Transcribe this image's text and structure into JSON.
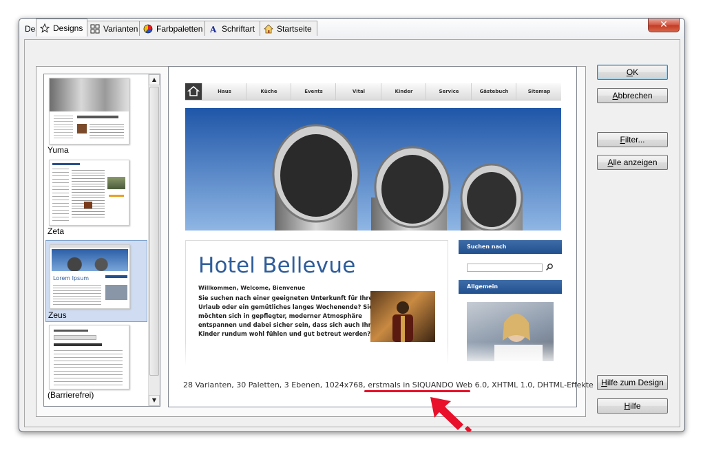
{
  "window": {
    "title": "Design auswählen",
    "close_glyph": "✕"
  },
  "tabs": [
    {
      "label": "Designs",
      "icon": "star-icon",
      "active": true
    },
    {
      "label": "Varianten",
      "icon": "grid-icon",
      "active": false
    },
    {
      "label": "Farbpaletten",
      "icon": "color-wheel-icon",
      "active": false
    },
    {
      "label": "Schriftart",
      "icon": "font-icon",
      "active": false
    },
    {
      "label": "Startseite",
      "icon": "home-icon",
      "active": false
    }
  ],
  "design_list": {
    "items": [
      {
        "label": "Yuma",
        "selected": false
      },
      {
        "label": "Zeta",
        "selected": false
      },
      {
        "label": "Zeus",
        "selected": true
      },
      {
        "label": "(Barrierefrei)",
        "selected": false
      }
    ]
  },
  "preview": {
    "nav_items": [
      "Haus",
      "Küche",
      "Events",
      "Vital",
      "Kinder",
      "Service",
      "Gästebuch",
      "Sitemap"
    ],
    "hotel_title": "Hotel Bellevue",
    "welcome": "Willkommen, Welcome, Bienvenue",
    "paragraph_lines": [
      "Sie suchen nach einer geeigneten Unterkunft für Ihren",
      "Urlaub oder ein gemütliches langes Wochenende? Sie",
      "möchten sich in gepflegter, moderner Atmosphäre",
      "entspannen und dabei sicher sein, dass sich auch Ihre",
      "Kinder rundum wohl fühlen und gut betreut werden?"
    ],
    "sidebar": {
      "search_header": "Suchen nach",
      "general_header": "Allgemein"
    },
    "info": {
      "before": "28 Varianten, 30 Paletten, 3 Ebenen, 1024x768, ",
      "highlight": "erstmals in SIQUANDO Web 6.0",
      "after": ", XHTML 1.0, DHTML-Effekte"
    }
  },
  "buttons": {
    "ok": {
      "pre": "",
      "key": "O",
      "post": "K"
    },
    "cancel": {
      "pre": "",
      "key": "A",
      "post": "bbrechen"
    },
    "filter": {
      "pre": "",
      "key": "F",
      "post": "ilter..."
    },
    "show_all": {
      "pre": "",
      "key": "A",
      "post": "lle anzeigen"
    },
    "design_help": {
      "pre": "",
      "key": "H",
      "post": "ilfe zum Design"
    },
    "help": {
      "pre": "",
      "key": "H",
      "post": "ilfe"
    }
  },
  "colors": {
    "annotation_red": "#e8102a",
    "title_blue": "#2f5d9a",
    "selection": "#cfdcf2"
  }
}
